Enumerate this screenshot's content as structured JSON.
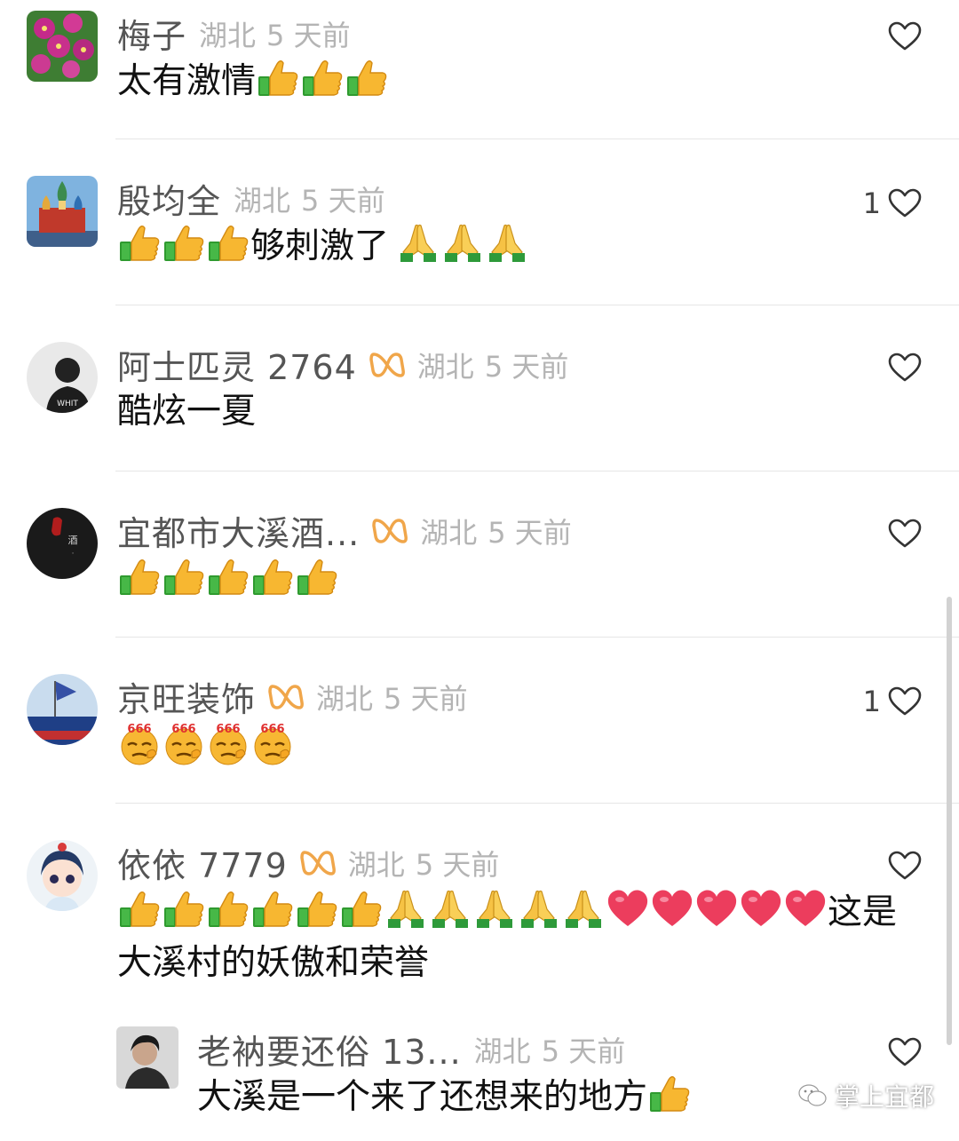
{
  "comments": [
    {
      "name": "梅子",
      "location": "湖北",
      "time": "5 天前",
      "likes": "",
      "text": "太有激情",
      "emoji_after": [
        "thumbs-up",
        "thumbs-up",
        "thumbs-up"
      ]
    },
    {
      "name": "殷均全",
      "location": "湖北",
      "time": "5 天前",
      "likes": "1",
      "text_before": "",
      "emoji_before": [
        "thumbs-up",
        "thumbs-up",
        "thumbs-up"
      ],
      "text": "够刺激了",
      "emoji_after": [
        "folded-hands",
        "folded-hands",
        "folded-hands"
      ]
    },
    {
      "name": "阿士匹灵 2764",
      "location": "湖北",
      "time": "5 天前",
      "likes": "",
      "text": "酷炫一夏",
      "badge": "infinity-badge"
    },
    {
      "name": "宜都市大溪酒...",
      "location": "湖北",
      "time": "5 天前",
      "likes": "",
      "emoji_after": [
        "thumbs-up",
        "thumbs-up",
        "thumbs-up",
        "thumbs-up",
        "thumbs-up"
      ],
      "badge": "infinity-badge"
    },
    {
      "name": "京旺装饰",
      "location": "湖北",
      "time": "5 天前",
      "likes": "1",
      "emoji_after": [
        "666-face",
        "666-face",
        "666-face",
        "666-face"
      ],
      "badge": "infinity-badge"
    },
    {
      "name": "依依 7779",
      "location": "湖北",
      "time": "5 天前",
      "likes": "",
      "text_after": "这是大溪村的妖傲和荣誉",
      "badge": "infinity-badge"
    },
    {
      "name": "老衲要还俗 13...",
      "location": "湖北",
      "time": "5 天前",
      "likes": "",
      "text": "大溪是一个来了还想来的地方",
      "emoji_after": [
        "thumbs-up"
      ]
    }
  ],
  "watermark": {
    "text": "掌上宜都",
    "icon": "wechat-icon"
  },
  "colors": {
    "badge": "#f0a64a",
    "name": "#555555",
    "meta": "#b4b4b4",
    "divider": "#e6e6e6"
  }
}
